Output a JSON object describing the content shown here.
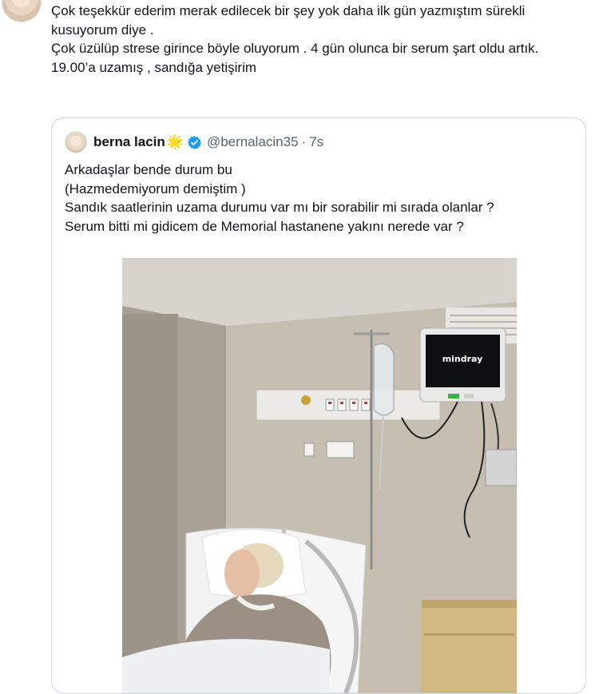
{
  "reply": {
    "lines": [
      "Çok teşekkür ederim merak edilecek bir şey yok daha ilk gün yazmıştım sürekli kusuyorum diye .",
      "Çok üzülüp strese girince böyle oluyorum . 4 gün olunca bir serum şart oldu artık.",
      "19.00’a uzamış , sandığa yetişirim"
    ]
  },
  "quoted": {
    "display_name": "berna lacin",
    "name_emoji": "🌟",
    "handle": "@bernalacin35",
    "separator": "·",
    "time": "7s",
    "lines": [
      "Arkadaşlar bende durum bu",
      "(Hazmedemiyorum demiştim )",
      "Sandık saatlerinin uzama durumu var mı bir sorabilir mi sırada olanlar ?",
      "Serum bitti mi gidicem de Memorial hastanene yakını nerede var ?"
    ],
    "media": {
      "monitor_brand": "mindray"
    }
  },
  "colors": {
    "text": "#0f1419",
    "muted": "#536471",
    "border": "#cfd9de",
    "verified": "#1d9bf0"
  }
}
